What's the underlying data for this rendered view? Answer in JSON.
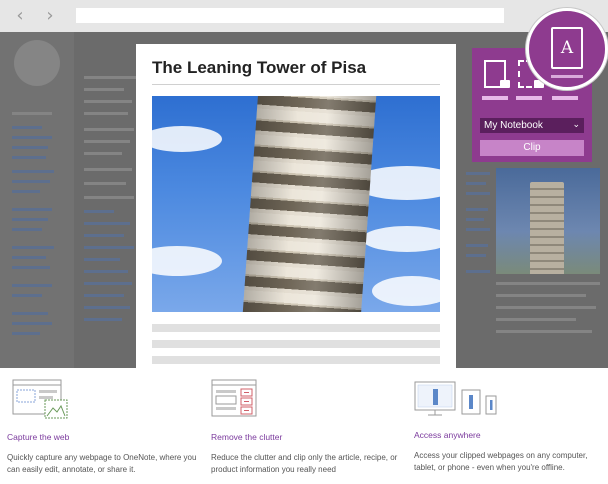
{
  "browser": {
    "back_icon": "chevron-left-icon",
    "forward_icon": "chevron-right-icon",
    "back_glyph": "‹",
    "forward_glyph": "›"
  },
  "article": {
    "title": "The Leaning Tower of Pisa"
  },
  "clipper": {
    "modes": [
      "full-page",
      "region",
      "article"
    ],
    "notebook": "My Notebook",
    "clip_label": "Clip",
    "badge_letter": "A",
    "colors": {
      "panel": "#8e3b8f",
      "dropdown": "#5b1f5d",
      "button": "#c784c8"
    }
  },
  "features": [
    {
      "title": "Capture the web",
      "description": "Quickly capture any webpage to OneNote, where you can easily edit, annotate, or share it."
    },
    {
      "title": "Remove the clutter",
      "description": "Reduce the clutter and clip only the article, recipe, or product information you really need"
    },
    {
      "title": "Access anywhere",
      "description": "Access your clipped webpages on any computer, tablet, or phone - even when you're offline."
    }
  ],
  "colors": {
    "accent": "#7b3a9d",
    "overlay": "#6b6b6b"
  }
}
